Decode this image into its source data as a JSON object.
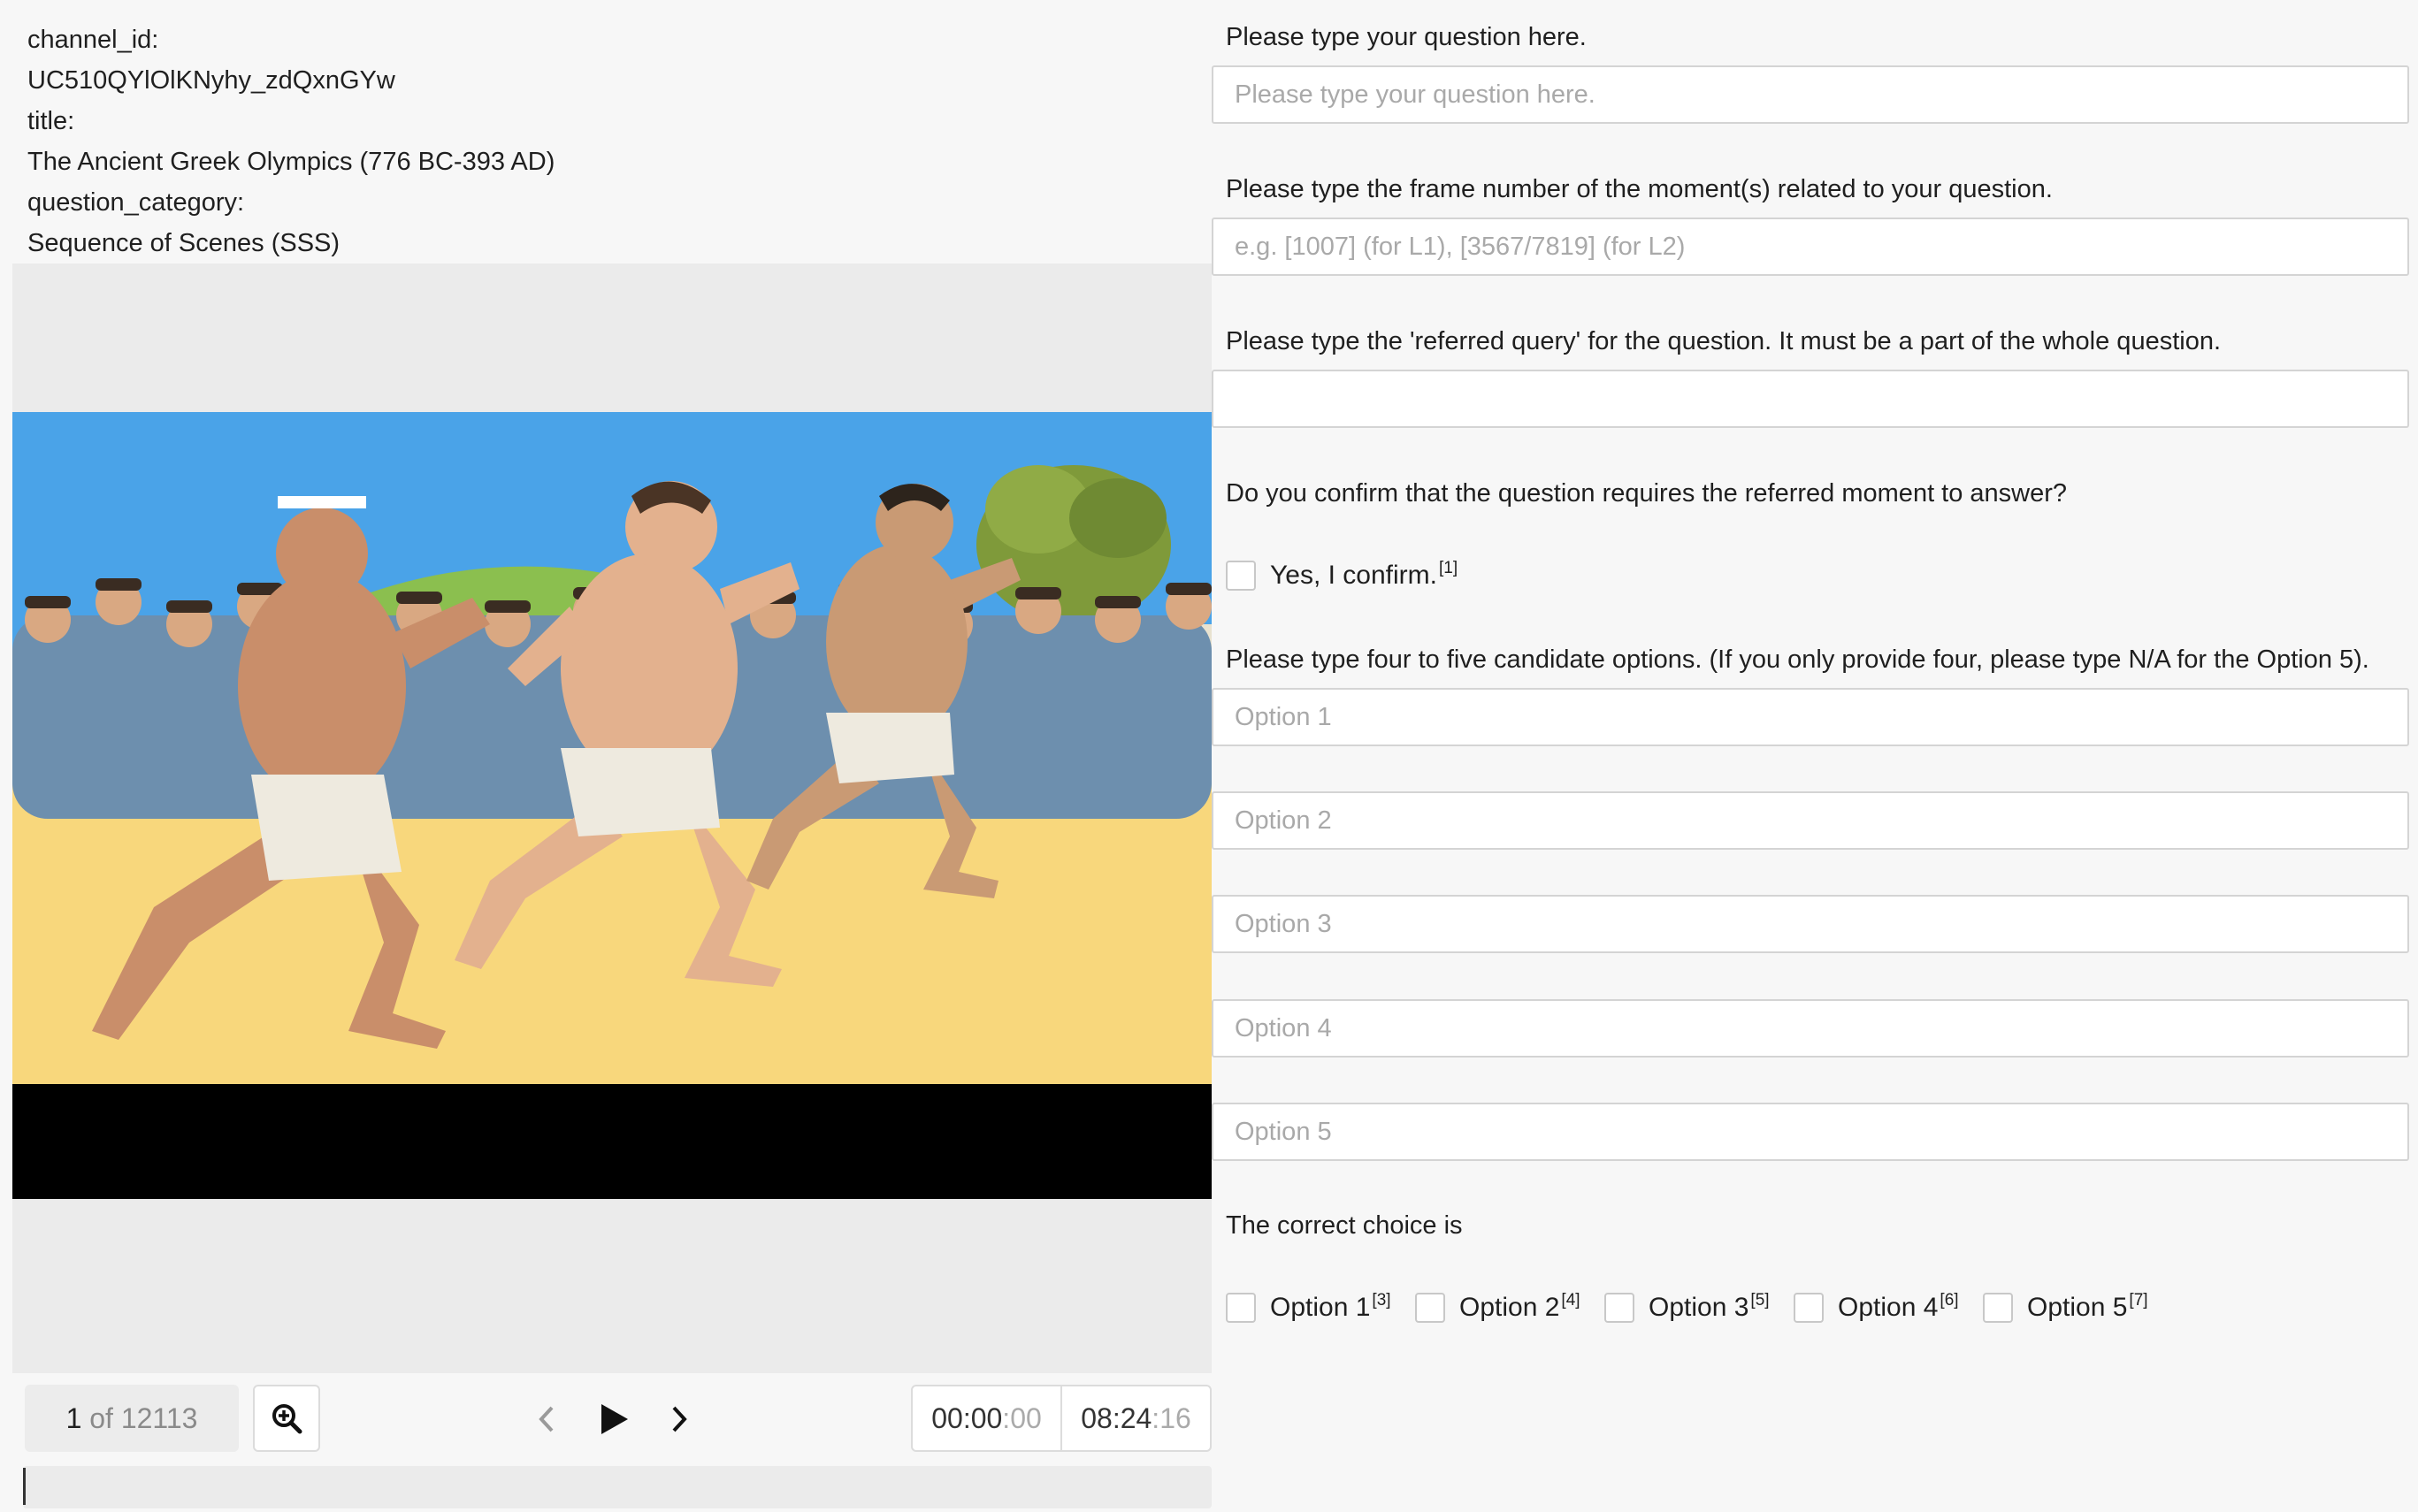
{
  "meta": {
    "channel_id_label": "channel_id:",
    "channel_id_value": "UC510QYlOlKNyhy_zdQxnGYw",
    "title_label": "title:",
    "title_value": "The Ancient Greek Olympics (776 BC-393 AD)",
    "category_label": "question_category:",
    "category_value": "Sequence of Scenes (SSS)"
  },
  "player": {
    "current_frame": "1",
    "frame_total": "of 12113",
    "current_time_main": "00:00",
    "current_time_frac": ":00",
    "total_time_main": "08:24",
    "total_time_frac": ":16",
    "icons": [
      "zoom-in-icon",
      "chevron-left-icon",
      "play-icon",
      "chevron-right-icon"
    ]
  },
  "form": {
    "question_label": "Please type your question here.",
    "question_placeholder": "Please type your question here.",
    "frame_label": "Please type the frame number of the moment(s) related to your question.",
    "frame_placeholder": "e.g. [1007] (for L1), [3567/7819] (for L2)",
    "query_label": "Please type the 'referred query' for the question. It must be a part of the whole question.",
    "query_placeholder": "",
    "confirm_question": "Do you confirm that the question requires the referred moment to answer?",
    "confirm_label": "Yes, I confirm.",
    "confirm_sup": "[1]",
    "options_label": "Please type four to five candidate options. (If you only provide four, please type N/A for the Option 5).",
    "option_placeholders": [
      "Option 1",
      "Option 2",
      "Option 3",
      "Option 4",
      "Option 5"
    ],
    "correct_label": "The correct choice is",
    "choices": [
      {
        "label": "Option 1",
        "sup": "[3]"
      },
      {
        "label": "Option 2",
        "sup": "[4]"
      },
      {
        "label": "Option 3",
        "sup": "[5]"
      },
      {
        "label": "Option 4",
        "sup": "[6]"
      },
      {
        "label": "Option 5",
        "sup": "[7]"
      }
    ]
  },
  "colors": {
    "sky": "#4aa3e8",
    "sand": "#f8d77c",
    "tunic": "#6d8fae",
    "skin": "#d9a882"
  }
}
